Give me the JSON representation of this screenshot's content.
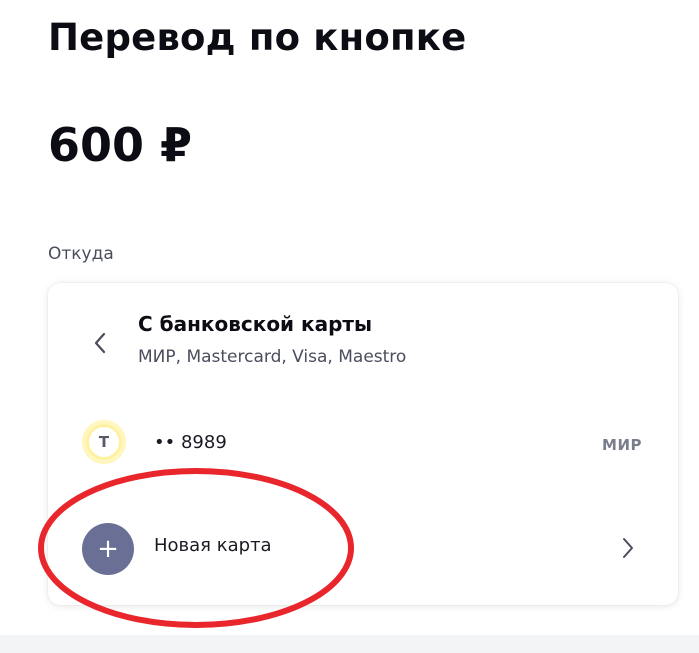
{
  "page": {
    "title": "Перевод по кнопке",
    "amount": "600 ₽"
  },
  "source": {
    "label": "Откуда",
    "method": {
      "title": "С банковской карты",
      "subtitle": "МИР, Mastercard, Visa, Maestro",
      "back_icon": "chevron-left-icon"
    },
    "saved_card": {
      "bank_logo_letter": "T",
      "number": "•• 8989",
      "network": "МИР"
    },
    "new_card": {
      "icon": "plus-icon",
      "icon_glyph": "+",
      "label": "Новая карта",
      "chevron_icon": "chevron-right-icon"
    }
  },
  "colors": {
    "text": "#0c0c14",
    "secondary_text": "#4a4d5e",
    "plus_circle": "#6a6f96",
    "bank_logo_bg": "#fff3a8",
    "highlight": "#e8262c"
  }
}
